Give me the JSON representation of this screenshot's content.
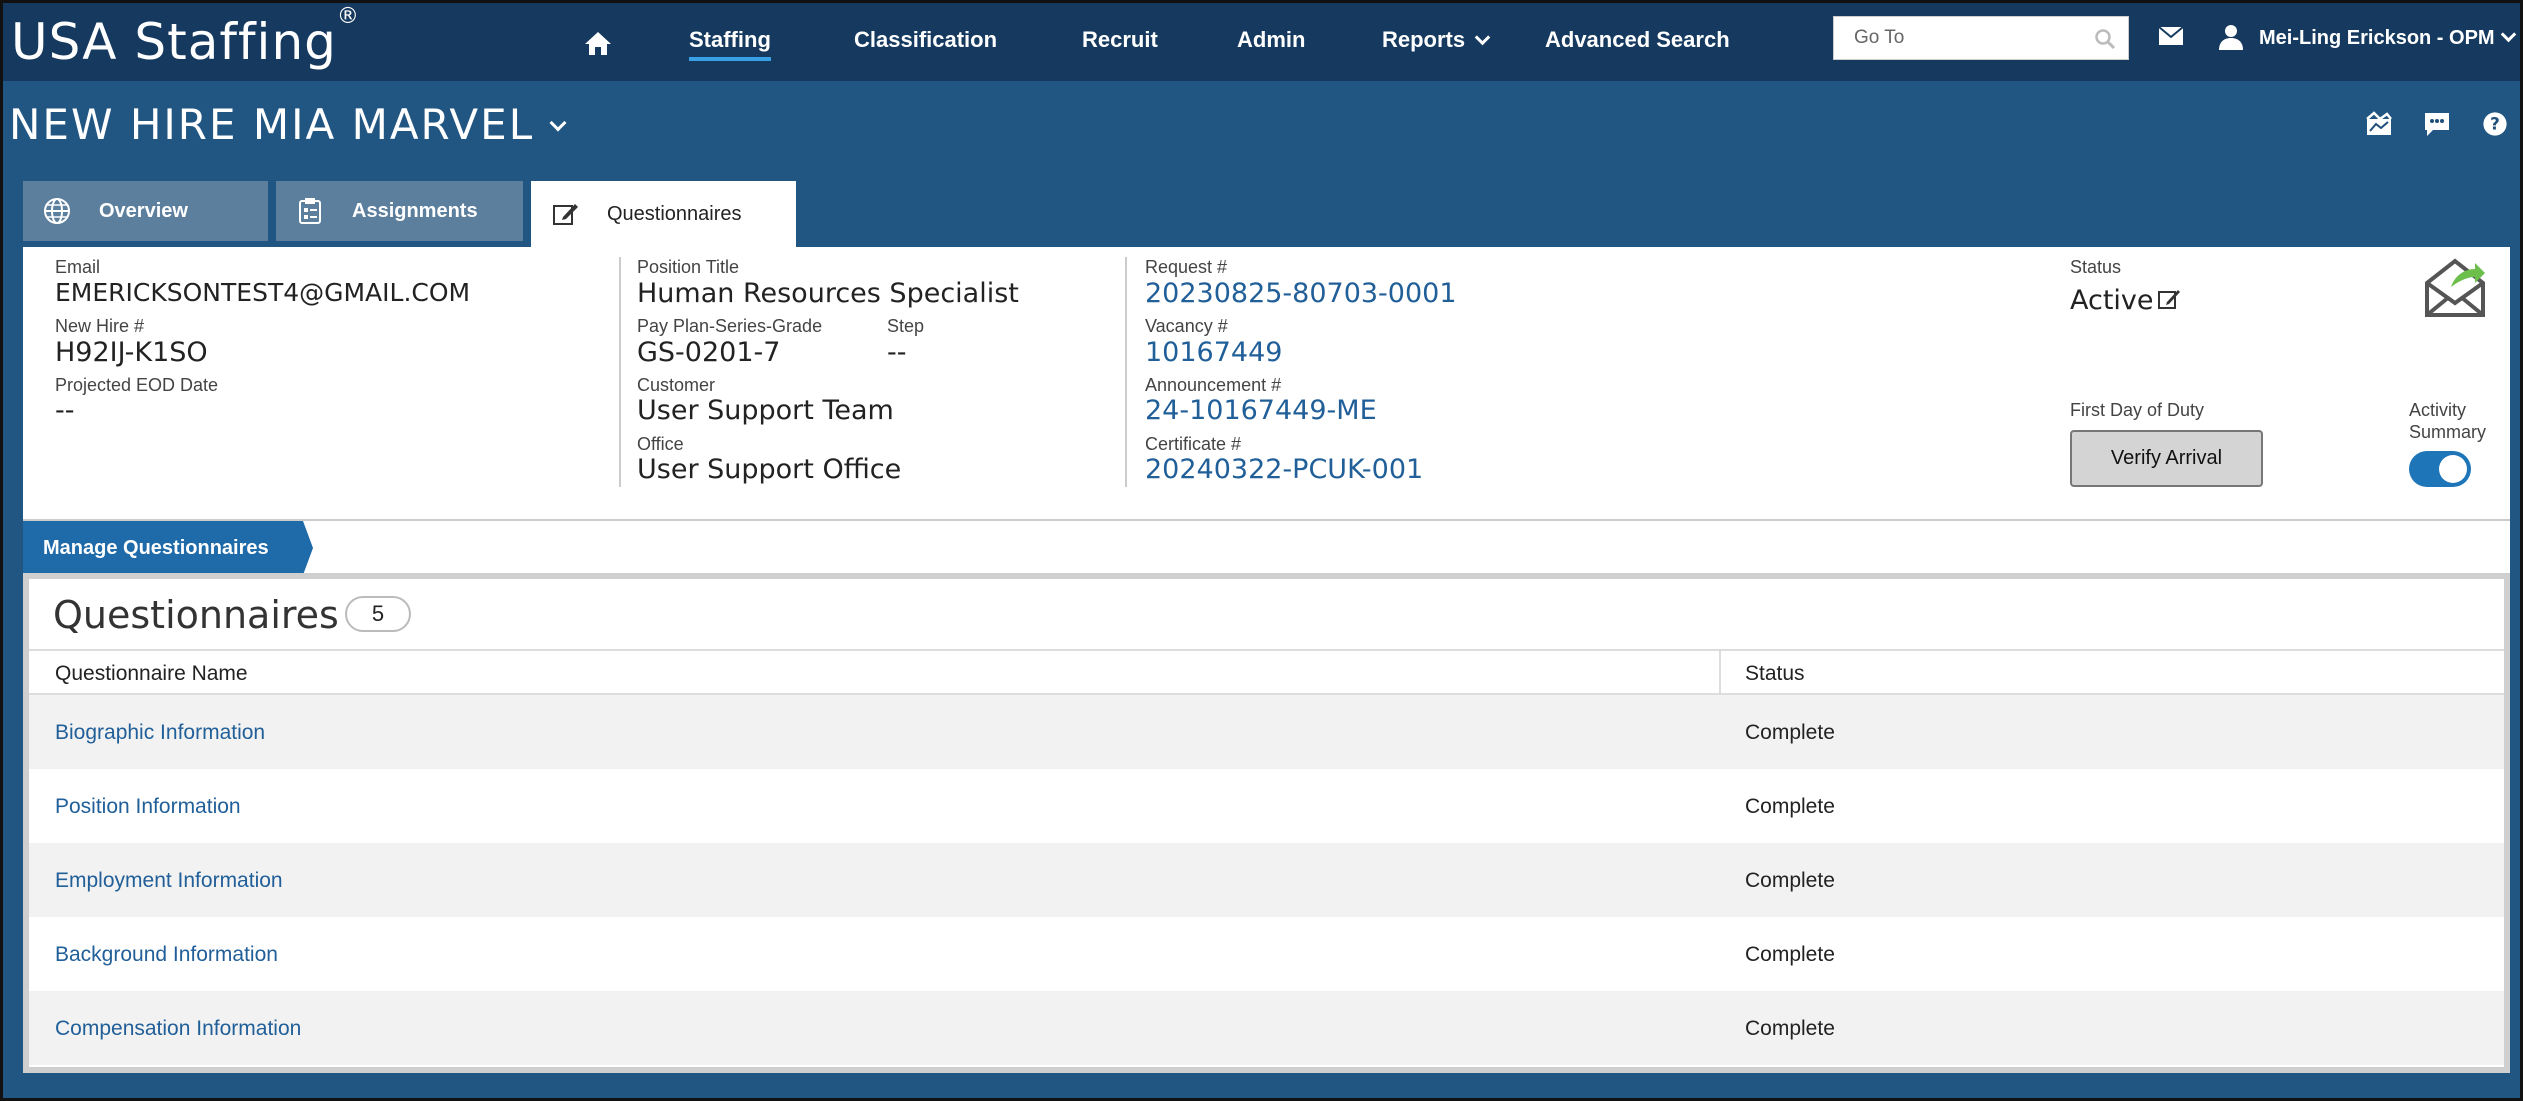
{
  "app": {
    "logo": "USA Staffing",
    "logo_mark": "®"
  },
  "nav": {
    "home_icon": "home-icon",
    "items": [
      {
        "label": "Staffing",
        "active": true
      },
      {
        "label": "Classification"
      },
      {
        "label": "Recruit"
      },
      {
        "label": "Admin"
      },
      {
        "label": "Reports",
        "has_dropdown": true
      },
      {
        "label": "Advanced Search"
      }
    ],
    "goto_placeholder": "Go To",
    "user_name": "Mei-Ling Erickson - OPM"
  },
  "page": {
    "title": "NEW HIRE MIA MARVEL",
    "right_icons": [
      "dashboard-icon",
      "comment-icon",
      "help-icon"
    ]
  },
  "tabs": [
    {
      "label": "Overview",
      "icon": "globe-icon"
    },
    {
      "label": "Assignments",
      "icon": "clipboard-icon"
    },
    {
      "label": "Questionnaires",
      "icon": "edit-icon",
      "active": true
    }
  ],
  "info": {
    "email_label": "Email",
    "email": "EMERICKSONTEST4@GMAIL.COM",
    "newhire_label": "New Hire #",
    "newhire": "H92IJ-K1SO",
    "eod_label": "Projected EOD Date",
    "eod": "--",
    "position_label": "Position Title",
    "position": "Human Resources Specialist",
    "ppsg_label": "Pay Plan-Series-Grade",
    "ppsg": "GS-0201-7",
    "step_label": "Step",
    "step": "--",
    "customer_label": "Customer",
    "customer": "User Support Team",
    "office_label": "Office",
    "office": "User Support Office",
    "request_label": "Request #",
    "request": "20230825-80703-0001",
    "vacancy_label": "Vacancy #",
    "vacancy": "10167449",
    "announcement_label": "Announcement #",
    "announcement": "24-10167449-ME",
    "certificate_label": "Certificate #",
    "certificate": "20240322-PCUK-001",
    "status_label": "Status",
    "status": "Active",
    "fdod_label": "First Day of Duty",
    "verify_button": "Verify Arrival",
    "activity_label_1": "Activity",
    "activity_label_2": "Summary",
    "activity_on": true
  },
  "manage_label": "Manage Questionnaires",
  "questionnaires": {
    "title": "Questionnaires",
    "count": "5",
    "col_name": "Questionnaire Name",
    "col_status": "Status",
    "rows": [
      {
        "name": "Biographic Information",
        "status": "Complete"
      },
      {
        "name": "Position Information",
        "status": "Complete"
      },
      {
        "name": "Employment Information",
        "status": "Complete"
      },
      {
        "name": "Background Information",
        "status": "Complete"
      },
      {
        "name": "Compensation Information",
        "status": "Complete"
      }
    ]
  },
  "colors": {
    "nav_bg": "#163a5f",
    "page_bg": "#215582",
    "link": "#215f99",
    "accent": "#1f6aa8"
  }
}
